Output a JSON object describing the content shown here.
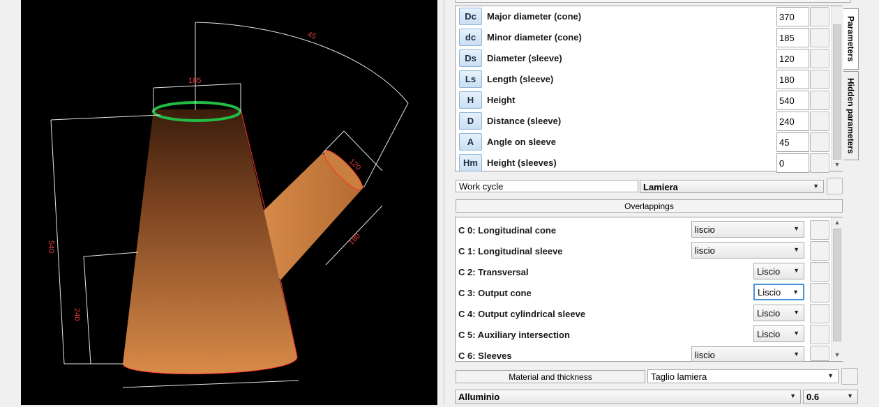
{
  "viewport": {
    "dimensions": {
      "top_diameter": "185",
      "angle": "45",
      "sleeve_diameter": "120",
      "sleeve_length": "180",
      "height": "540",
      "distance": "240"
    },
    "colors": {
      "body": "#c97a3c",
      "edge": "#ff3030",
      "rim": "#22bb44",
      "dim": "#e6e6e6",
      "label": "#e23a3a"
    }
  },
  "params": {
    "tabs": [
      {
        "label": "Parameters"
      },
      {
        "label": "Hidden parameters"
      }
    ],
    "items": [
      {
        "code": "Dc",
        "label": "Major diameter (cone)",
        "value": "370"
      },
      {
        "code": "dc",
        "label": "Minor diameter (cone)",
        "value": "185"
      },
      {
        "code": "Ds",
        "label": "Diameter (sleeve)",
        "value": "120"
      },
      {
        "code": "Ls",
        "label": "Length (sleeve)",
        "value": "180"
      },
      {
        "code": "H",
        "label": "Height",
        "value": "540"
      },
      {
        "code": "D",
        "label": "Distance (sleeve)",
        "value": "240"
      },
      {
        "code": "A",
        "label": "Angle on sleeve",
        "value": "45"
      },
      {
        "code": "Hm",
        "label": "Height (sleeves)",
        "value": "0"
      }
    ]
  },
  "work_cycle": {
    "label": "Work cycle",
    "value": "Lamiera"
  },
  "overlappings": {
    "title": "Overlappings",
    "items": [
      {
        "label": "C 0: Longitudinal cone",
        "value": "liscio"
      },
      {
        "label": "C 1: Longitudinal sleeve",
        "value": "liscio"
      },
      {
        "label": "C 2: Transversal",
        "value": "Liscio"
      },
      {
        "label": "C 3: Output cone",
        "value": "Liscio"
      },
      {
        "label": "C 4: Output cylindrical sleeve",
        "value": "Liscio"
      },
      {
        "label": "C 5: Auxiliary intersection",
        "value": "Liscio"
      },
      {
        "label": "C 6: Sleeves",
        "value": "liscio"
      }
    ]
  },
  "material": {
    "label": "Material and thickness",
    "cut": "Taglio lamiera",
    "material": "Alluminio",
    "thickness": "0.6"
  }
}
